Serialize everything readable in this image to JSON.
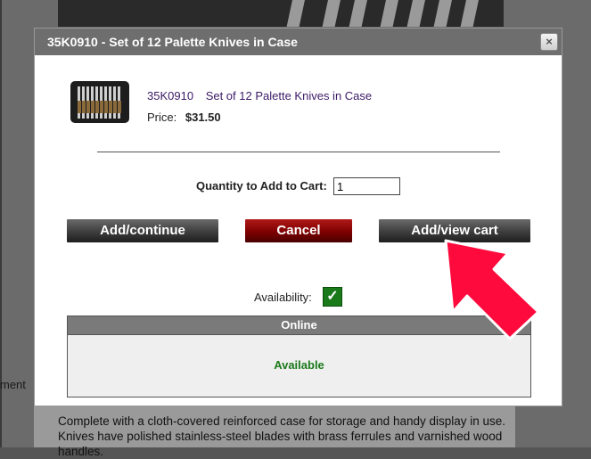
{
  "background": {
    "sidebar_fragment": "ment",
    "description": "Complete with a cloth-covered reinforced case for storage and handy display in use. Knives have polished stainless-steel blades with brass ferrules and varnished wood handles."
  },
  "modal": {
    "title": "35K0910 - Set of 12 Palette Knives in Case",
    "close_label": "×",
    "product": {
      "sku": "35K0910",
      "name": "Set of 12 Palette Knives in Case",
      "price_label": "Price:",
      "price": "$31.50"
    },
    "quantity": {
      "label": "Quantity to Add to Cart:",
      "value": "1"
    },
    "buttons": {
      "continue": "Add/continue",
      "cancel": "Cancel",
      "view_cart": "Add/view cart"
    },
    "availability": {
      "label": "Availability:",
      "check": "✓",
      "table_header": "Online",
      "status": "Available"
    }
  },
  "colors": {
    "product_link": "#3b1a66",
    "available_text": "#1c7a1c",
    "cancel_button": "#7d0000",
    "arrow": "#ff0a3c"
  }
}
